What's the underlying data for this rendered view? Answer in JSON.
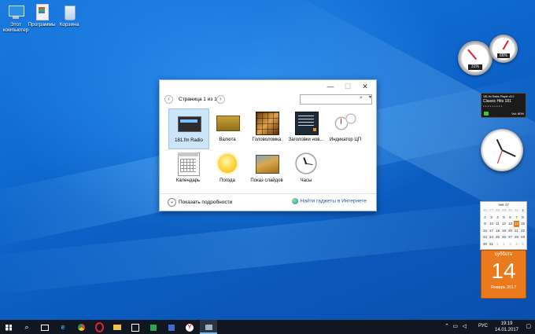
{
  "desktop": {
    "icons": [
      {
        "label": "Этот компьютер",
        "icon": "computer-icon"
      },
      {
        "label": "Программы",
        "icon": "folder-doc-icon"
      },
      {
        "label": "Корзина",
        "icon": "recycle-bin-icon"
      }
    ]
  },
  "gadget_window": {
    "page_label": "Страница 1 из 1",
    "search_placeholder": "",
    "gadgets": [
      {
        "label": "181.fm Radio",
        "icon": "radio-icon"
      },
      {
        "label": "Валюта",
        "icon": "currency-icon"
      },
      {
        "label": "Головоломка",
        "icon": "puzzle-icon"
      },
      {
        "label": "Заголовки нов...",
        "icon": "news-icon"
      },
      {
        "label": "Индикатор ЦП",
        "icon": "cpu-meter-icon"
      },
      {
        "label": "Календарь",
        "icon": "calendar-icon"
      },
      {
        "label": "Погода",
        "icon": "weather-icon"
      },
      {
        "label": "Показ слайдов",
        "icon": "slideshow-icon"
      },
      {
        "label": "Часы",
        "icon": "clock-icon"
      }
    ],
    "show_details": "Показать подробности",
    "get_online": "Найти гаджеты в Интернете"
  },
  "cpu_gadget": {
    "cpu": "31%",
    "ram": "66%"
  },
  "radio_gadget": {
    "title": "181.fm Radio Player v3.0",
    "station": "Classic Hits 181",
    "volume": "Vol: 80%"
  },
  "calendar_gadget": {
    "month": "янв 17",
    "weeks": [
      [
        "26",
        "27",
        "28",
        "29",
        "30",
        "31",
        "1"
      ],
      [
        "2",
        "3",
        "4",
        "5",
        "6",
        "7",
        "8"
      ],
      [
        "9",
        "10",
        "11",
        "12",
        "13",
        "14",
        "15"
      ],
      [
        "16",
        "17",
        "18",
        "19",
        "20",
        "21",
        "22"
      ],
      [
        "23",
        "24",
        "25",
        "26",
        "27",
        "28",
        "29"
      ],
      [
        "30",
        "31",
        "1",
        "2",
        "3",
        "4",
        "5"
      ]
    ],
    "today": "14",
    "weekday": "суббота",
    "month_year": "Январь 2017"
  },
  "taskbar": {
    "lang": "РУС",
    "time": "19:19",
    "date": "14.01.2017"
  }
}
